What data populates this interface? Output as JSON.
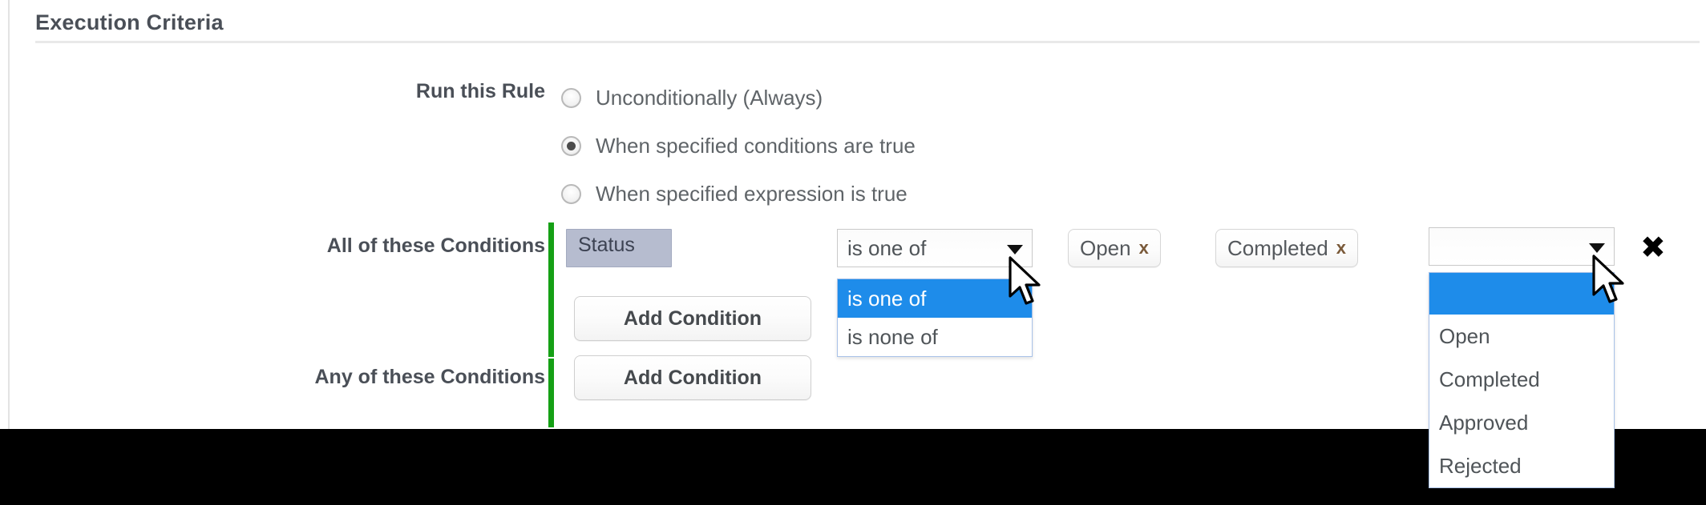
{
  "section": {
    "title": "Execution Criteria"
  },
  "run_rule": {
    "label": "Run this Rule",
    "options": [
      {
        "label": "Unconditionally (Always)",
        "checked": false
      },
      {
        "label": "When specified conditions are true",
        "checked": true
      },
      {
        "label": "When specified expression is true",
        "checked": false
      }
    ]
  },
  "all_conditions": {
    "label": "All of these Conditions",
    "add_button": "Add Condition",
    "condition": {
      "field": "Status",
      "operator_select": {
        "value": "is one of",
        "open": true,
        "options": [
          "is one of",
          "is none of"
        ],
        "highlighted": "is one of"
      },
      "value_chips": [
        {
          "label": "Open",
          "remove": "x"
        },
        {
          "label": "Completed",
          "remove": "x"
        }
      ],
      "value_select": {
        "value": "",
        "open": true,
        "options": [
          "",
          "Open",
          "Completed",
          "Approved",
          "Rejected"
        ],
        "highlighted": ""
      },
      "delete_label": "✖"
    }
  },
  "any_conditions": {
    "label": "Any of these Conditions",
    "add_button": "Add Condition"
  },
  "icons": {
    "dropdown_arrow": "chevron-down-icon",
    "cursor": "mouse-pointer-icon"
  },
  "colors": {
    "group_rail_green": "#15a015",
    "highlight_blue": "#1e8cea",
    "field_token_bg": "#b6bccf",
    "label_text": "#4a4f57",
    "body_text": "#5f6468"
  }
}
